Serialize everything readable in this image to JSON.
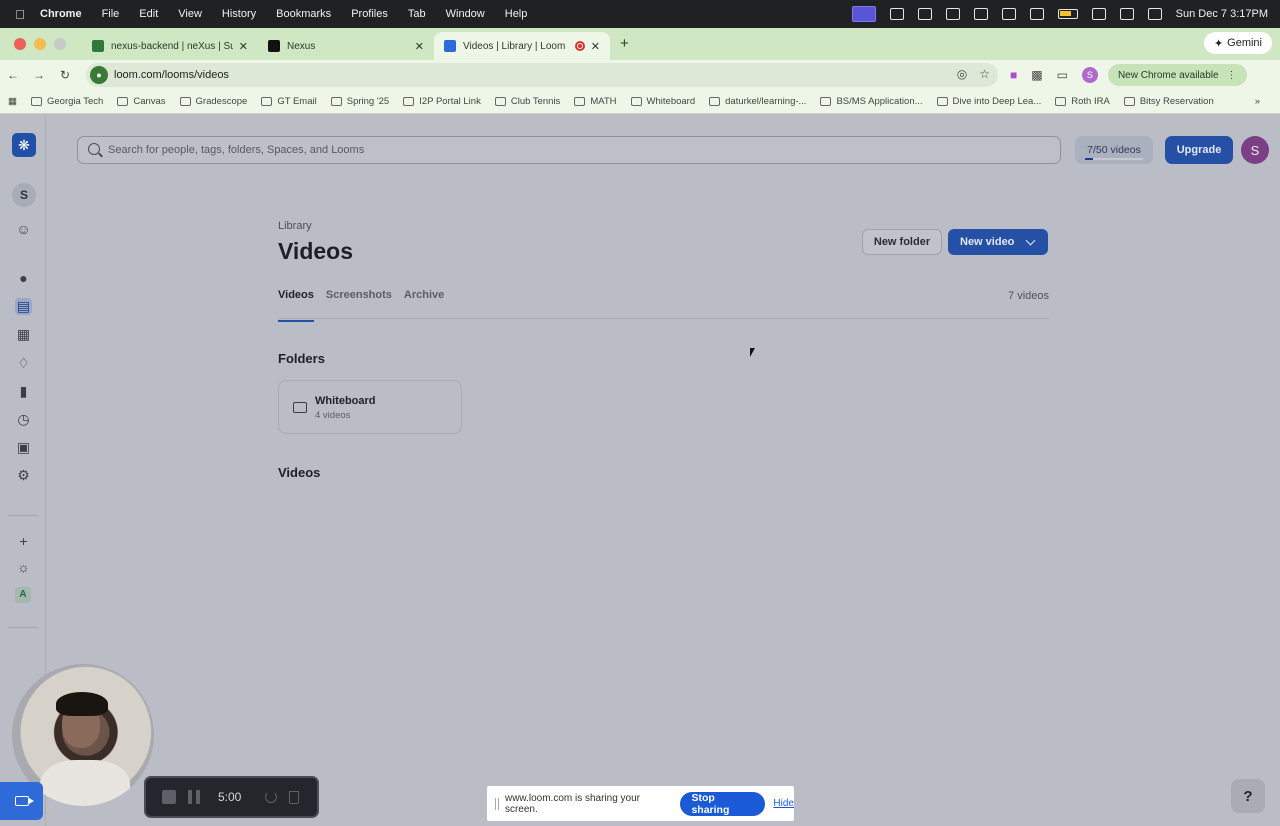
{
  "menubar": {
    "apple_icon": "apple-icon",
    "items": [
      "Chrome",
      "File",
      "Edit",
      "View",
      "History",
      "Bookmarks",
      "Profiles",
      "Tab",
      "Window",
      "Help"
    ],
    "datetime": "Sun Dec 7  3:17PM"
  },
  "browser": {
    "tabs": [
      {
        "title": "nexus-backend | neXus | Sup",
        "favicon_color": "#2f7a3a"
      },
      {
        "title": "Nexus",
        "favicon_color": "#111111"
      },
      {
        "title": "Videos | Library | Loom",
        "favicon_color": "#2f6bd8"
      }
    ],
    "new_tab": "+",
    "gemini": "Gemini",
    "url": "loom.com/looms/videos",
    "new_chrome": "New Chrome available",
    "profile_initial": "S",
    "bookmarks": [
      "Georgia Tech",
      "Canvas",
      "Gradescope",
      "GT Email",
      "Spring '25",
      "I2P Portal Link",
      "Club Tennis",
      "MATH",
      "Whiteboard",
      "daturkel/learning-...",
      "BS/MS Application...",
      "Dive into Deep Lea...",
      "Roth IRA",
      "Bitsy Reservation"
    ]
  },
  "loom": {
    "workspace_initial": "S",
    "search_placeholder": "Search for people, tags, folders, Spaces, and Looms",
    "video_quota": "7/50 videos",
    "video_quota_fraction": 0.14,
    "upgrade_label": "Upgrade",
    "avatar_initial": "S",
    "breadcrumb": "Library",
    "title": "Videos",
    "new_folder_label": "New folder",
    "new_video_label": "New video",
    "tabs": [
      "Videos",
      "Screenshots",
      "Archive"
    ],
    "video_count": "7 videos",
    "folders_heading": "Folders",
    "folder": {
      "name": "Whiteboard",
      "count": "4 videos"
    },
    "videos_heading": "Videos",
    "left_nav_agent_initial": "A"
  },
  "recorder": {
    "timer": "5:00"
  },
  "share_bar": {
    "message": "www.loom.com is sharing your screen.",
    "stop_label": "Stop sharing",
    "hide_label": "Hide"
  },
  "help_label": "?",
  "colors": {
    "accent": "#2550a6",
    "chrome_bar": "#cfe7c2",
    "stop_sharing": "#1a5ad6"
  }
}
